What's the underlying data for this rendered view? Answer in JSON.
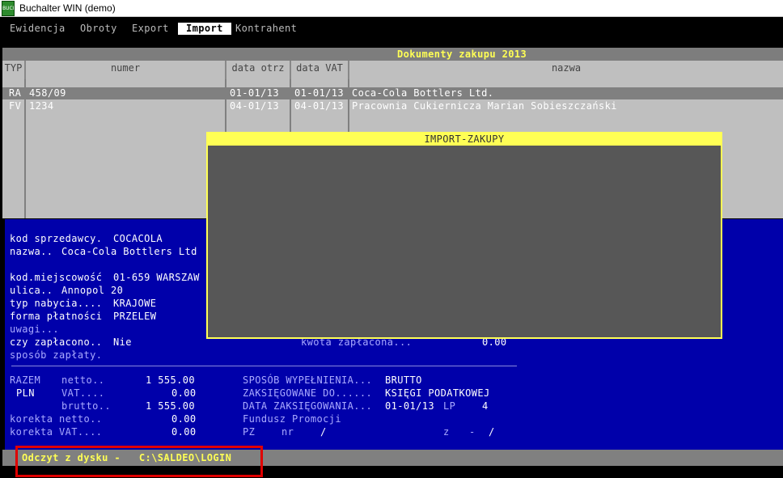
{
  "window": {
    "title": "Buchalter WIN (demo)",
    "icon_label": "BUCH"
  },
  "menu": [
    {
      "label": "Ewidencja",
      "active": false
    },
    {
      "label": "Obroty",
      "active": false
    },
    {
      "label": "Export",
      "active": false
    },
    {
      "label": "Import",
      "active": true
    },
    {
      "label": "Kontrahent",
      "active": false
    }
  ],
  "header_title": "Dokumenty zakupu 2013",
  "columns": [
    "TYP",
    "numer",
    "data otrz",
    "data VAT",
    "nazwa"
  ],
  "rows": [
    {
      "typ": "RA",
      "numer": "458/09",
      "data_otrz": "01-01/13",
      "data_vat": "01-01/13",
      "nazwa": "Coca-Cola Bottlers Ltd."
    },
    {
      "typ": "FV",
      "numer": "1234",
      "data_otrz": "04-01/13",
      "data_vat": "04-01/13",
      "nazwa": "Pracownia Cukiernicza Marian Sobieszczański"
    }
  ],
  "details": {
    "kod_sprzedawcy_label": "kod sprzedawcy.",
    "kod_sprzedawcy_value": "COCACOLA",
    "nazwa_label": "nazwa..",
    "nazwa_value": "Coca-Cola Bottlers Ltd",
    "kod_miejscowosc_label": "kod.miejscowość",
    "kod_miejscowosc_value": "01-659 WARSZAW",
    "ulica_label": "ulica..",
    "ulica_value": "Annopol 20",
    "typ_nabycia_label": "typ nabycia....",
    "typ_nabycia_value": "KRAJOWE",
    "forma_platnosci_label": "forma płatności",
    "forma_platnosci_value": "PRZELEW",
    "uwagi_label": "uwagi...",
    "czy_zaplacono_label": "czy zapłacono..",
    "czy_zaplacono_value": "Nie",
    "kwota_zaplacona_label": "kwota zapłacona...",
    "kwota_zaplacona_value": "0.00",
    "sposob_zaplaty_label": "sposób zapłaty."
  },
  "totals": {
    "razem": "RAZEM",
    "pln": "PLN",
    "netto_label": "netto..",
    "netto_value": "1 555.00",
    "vat_label": "VAT....",
    "vat_value": "0.00",
    "brutto_label": "brutto..",
    "brutto_value": "1 555.00",
    "korekta_netto_label": "korekta netto..",
    "korekta_netto_value": "0.00",
    "korekta_vat_label": "korekta VAT....",
    "korekta_vat_value": "0.00",
    "sposob_wypelnienia_label": "SPOSÓB WYPEŁNIENIA...",
    "sposob_wypelnienia_value": "BRUTTO",
    "zaksiegowane_do_label": "ZAKSIĘGOWANE DO......",
    "zaksiegowane_do_value": "KSIĘGI PODATKOWEJ",
    "data_zaksiegowania_label": "DATA ZAKSIĘGOWANIA...",
    "data_zaksiegowania_value": "01-01/13",
    "lp_label": "LP",
    "lp_value": "4",
    "fundusz_promocji_label": "Fundusz Promocji",
    "pz_label": "PZ",
    "nr_label": "nr",
    "nr_value": "/",
    "z_label": "z",
    "z_dash": "-",
    "z_value": "/"
  },
  "dialog": {
    "title": "IMPORT-ZAKUPY"
  },
  "status": {
    "text": "Odczyt z dysku -   C:\\SALDEO\\LOGIN"
  },
  "colors": {
    "console_blue": "#0000aa",
    "highlight_yellow": "#ffff55",
    "grid_gray": "#bfbfbf",
    "annotation_red": "#e00000"
  }
}
